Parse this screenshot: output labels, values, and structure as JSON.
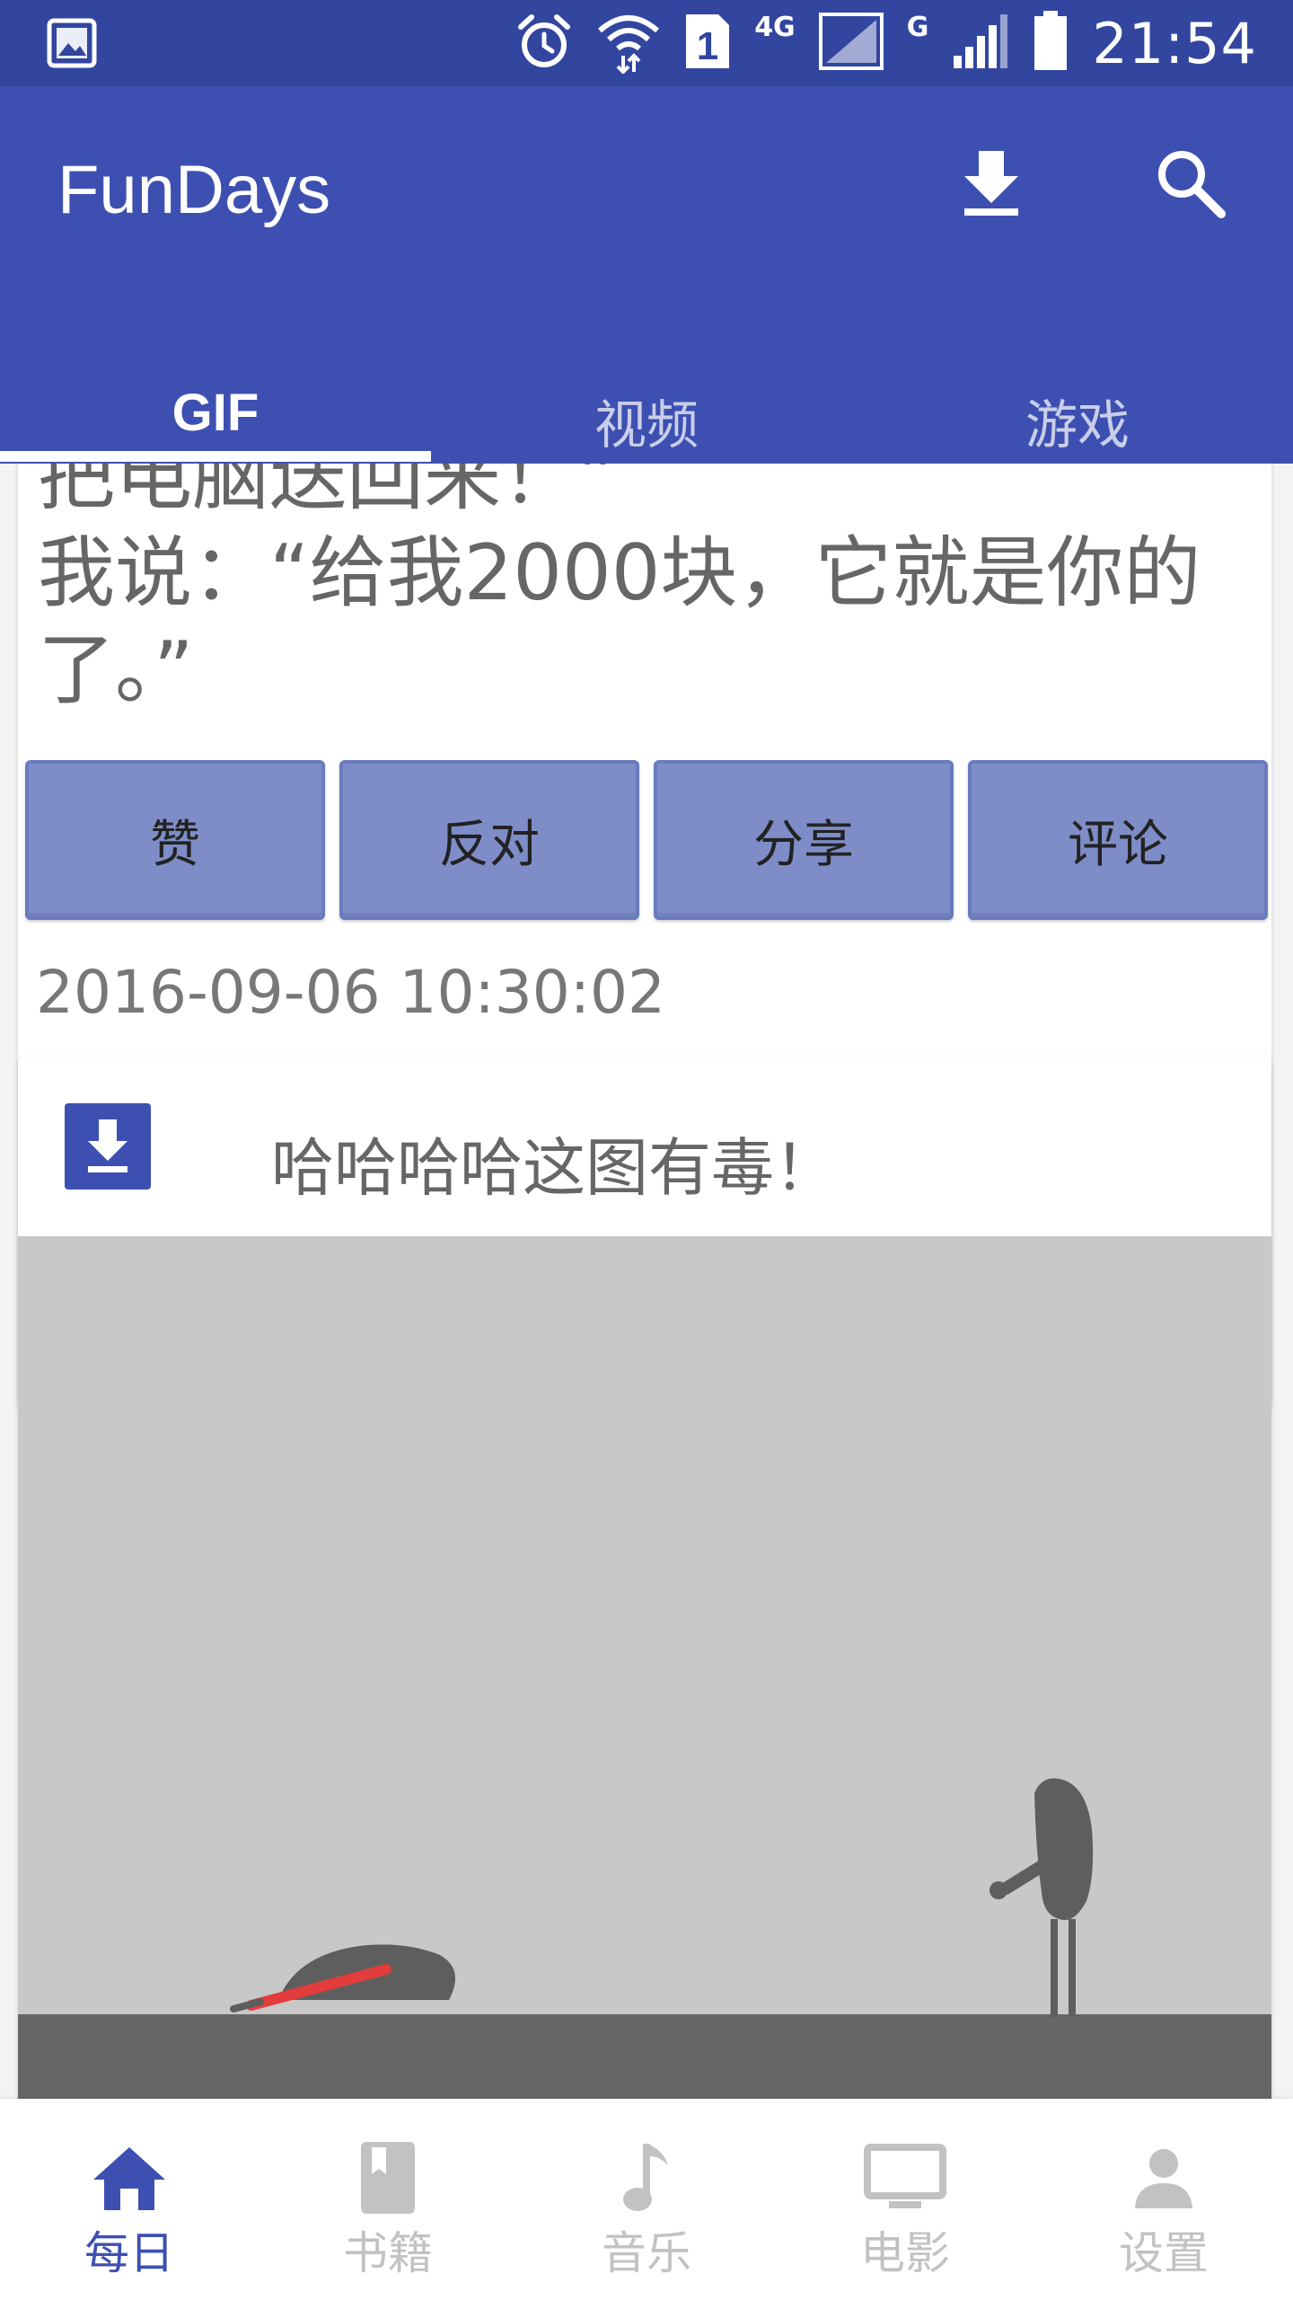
{
  "status_bar": {
    "sim_slot": "1",
    "network_primary": "4G",
    "network_secondary": "G",
    "time": "21:54",
    "icons": [
      "gallery-icon",
      "alarm-icon",
      "wifi-icon",
      "sim-icon",
      "signal-icon",
      "battery-icon"
    ]
  },
  "app_bar": {
    "title": "FunDays",
    "actions": [
      "download-icon",
      "search-icon"
    ]
  },
  "tabs": [
    {
      "label": "GIF",
      "active": true
    },
    {
      "label": "视频",
      "active": false
    },
    {
      "label": "游戏",
      "active": false
    }
  ],
  "card1": {
    "lines": [
      "把电脑送回来！”",
      "我说：“给我2000块，它就是你的",
      "了。”"
    ],
    "actions": [
      "赞",
      "反对",
      "分享",
      "评论"
    ]
  },
  "card2": {
    "timestamp": "2016-09-06 10:30:02",
    "title": "哈哈哈哈这图有毒！"
  },
  "bottom_nav": [
    {
      "label": "每日",
      "icon": "home-icon",
      "active": true
    },
    {
      "label": "书籍",
      "icon": "book-icon",
      "active": false
    },
    {
      "label": "音乐",
      "icon": "music-icon",
      "active": false
    },
    {
      "label": "电影",
      "icon": "tv-icon",
      "active": false
    },
    {
      "label": "设置",
      "icon": "person-icon",
      "active": false
    }
  ],
  "colors": {
    "primary": "#3d50b1",
    "status_bar": "#3246a0",
    "button": "#7e8dc8",
    "background": "#f3f3f3"
  }
}
